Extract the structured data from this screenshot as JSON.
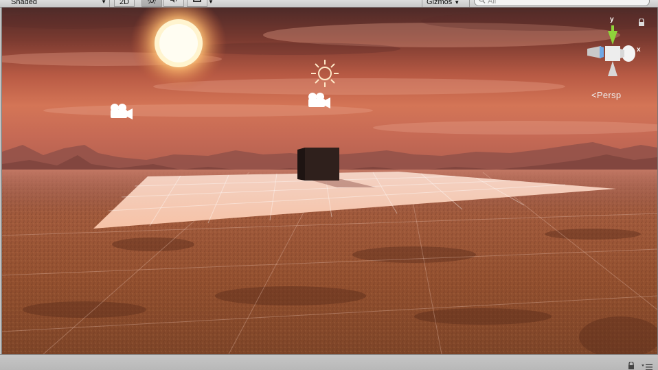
{
  "toolbar": {
    "draw_mode": "Shaded",
    "mode_2d_label": "2D",
    "lighting_icon": "sun-icon",
    "audio_icon": "speaker-icon",
    "effects_icon": "image-icon",
    "gizmos_label": "Gizmos",
    "search_placeholder": "All"
  },
  "scene_gizmo": {
    "y_label": "y",
    "x_label": "x",
    "projection_label": "Persp",
    "colors": {
      "y_axis": "#8fd43a",
      "x_axis": "#ffffff",
      "z_axis": "#6fa8e6"
    }
  },
  "scene": {
    "objects": [
      "directional-light",
      "camera-left",
      "camera-center",
      "cube",
      "plane",
      "terrain",
      "skybox"
    ],
    "icons": {
      "light": "sun-gizmo-icon",
      "camera": "camera-gizmo-icon"
    }
  }
}
